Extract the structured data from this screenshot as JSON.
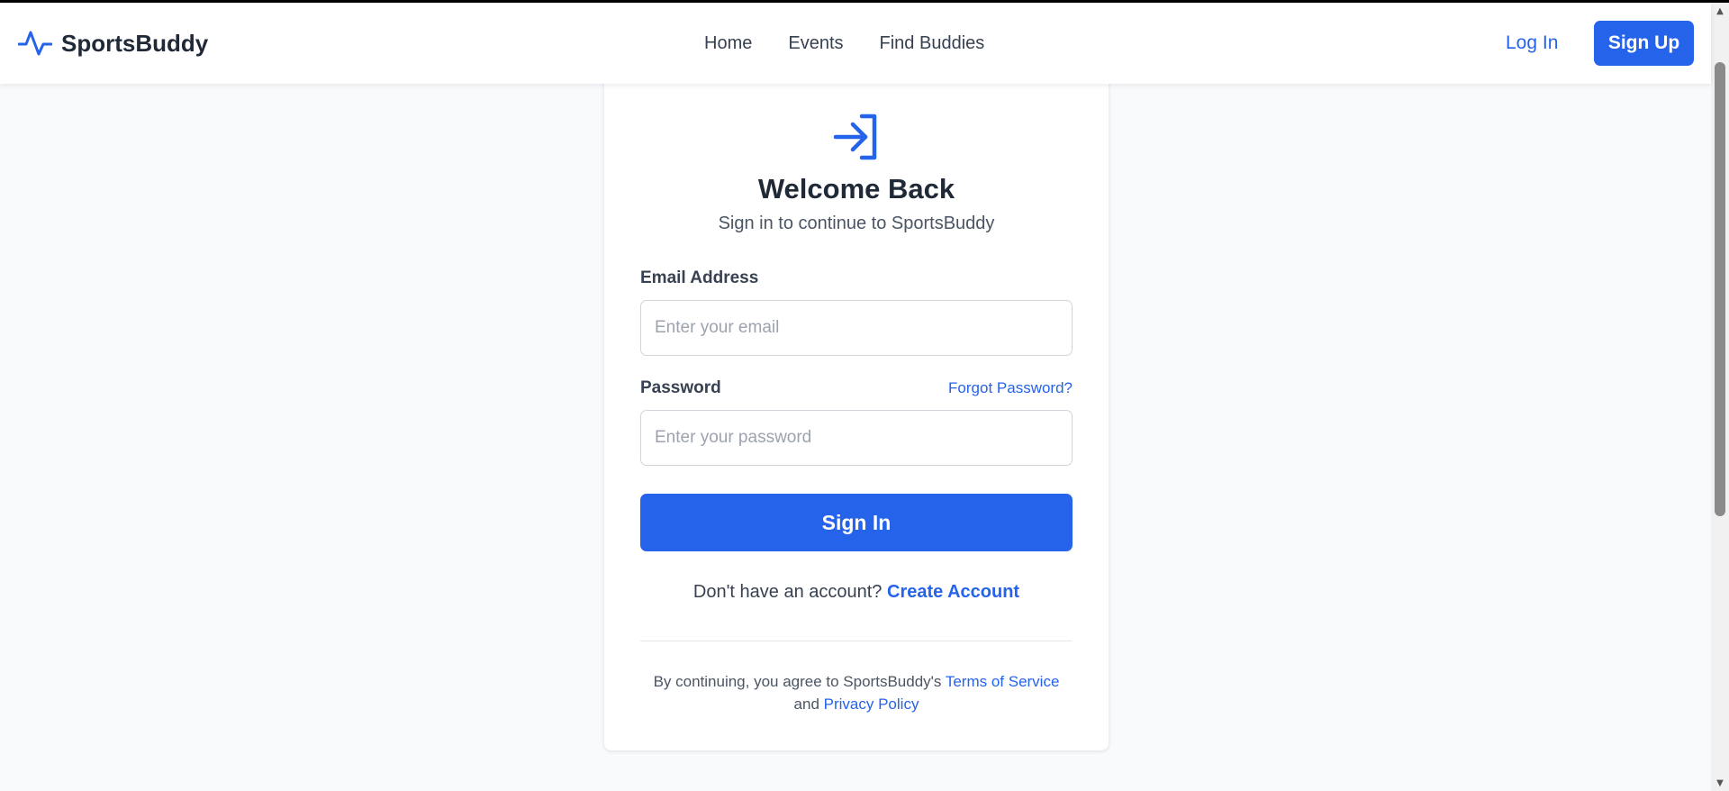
{
  "header": {
    "brand": {
      "name": "SportsBuddy",
      "icon": "activity-pulse-icon"
    },
    "nav": [
      {
        "label": "Home"
      },
      {
        "label": "Events"
      },
      {
        "label": "Find Buddies"
      }
    ],
    "login_label": "Log In",
    "signup_label": "Sign Up"
  },
  "login_card": {
    "icon": "login-arrow-icon",
    "title": "Welcome Back",
    "subtitle": "Sign in to continue to SportsBuddy",
    "email": {
      "label": "Email Address",
      "placeholder": "Enter your email",
      "value": ""
    },
    "password": {
      "label": "Password",
      "placeholder": "Enter your password",
      "value": "",
      "forgot_label": "Forgot Password?"
    },
    "submit_label": "Sign In",
    "signup_prompt": {
      "text": "Don't have an account?",
      "link_label": "Create Account"
    },
    "legal": {
      "prefix": "By continuing, you agree to SportsBuddy's",
      "terms_label": "Terms of Service",
      "conjunction": "and",
      "privacy_label": "Privacy Policy"
    }
  },
  "colors": {
    "accent": "#2563eb",
    "background": "#f8fafc",
    "text": "#1f2937"
  }
}
